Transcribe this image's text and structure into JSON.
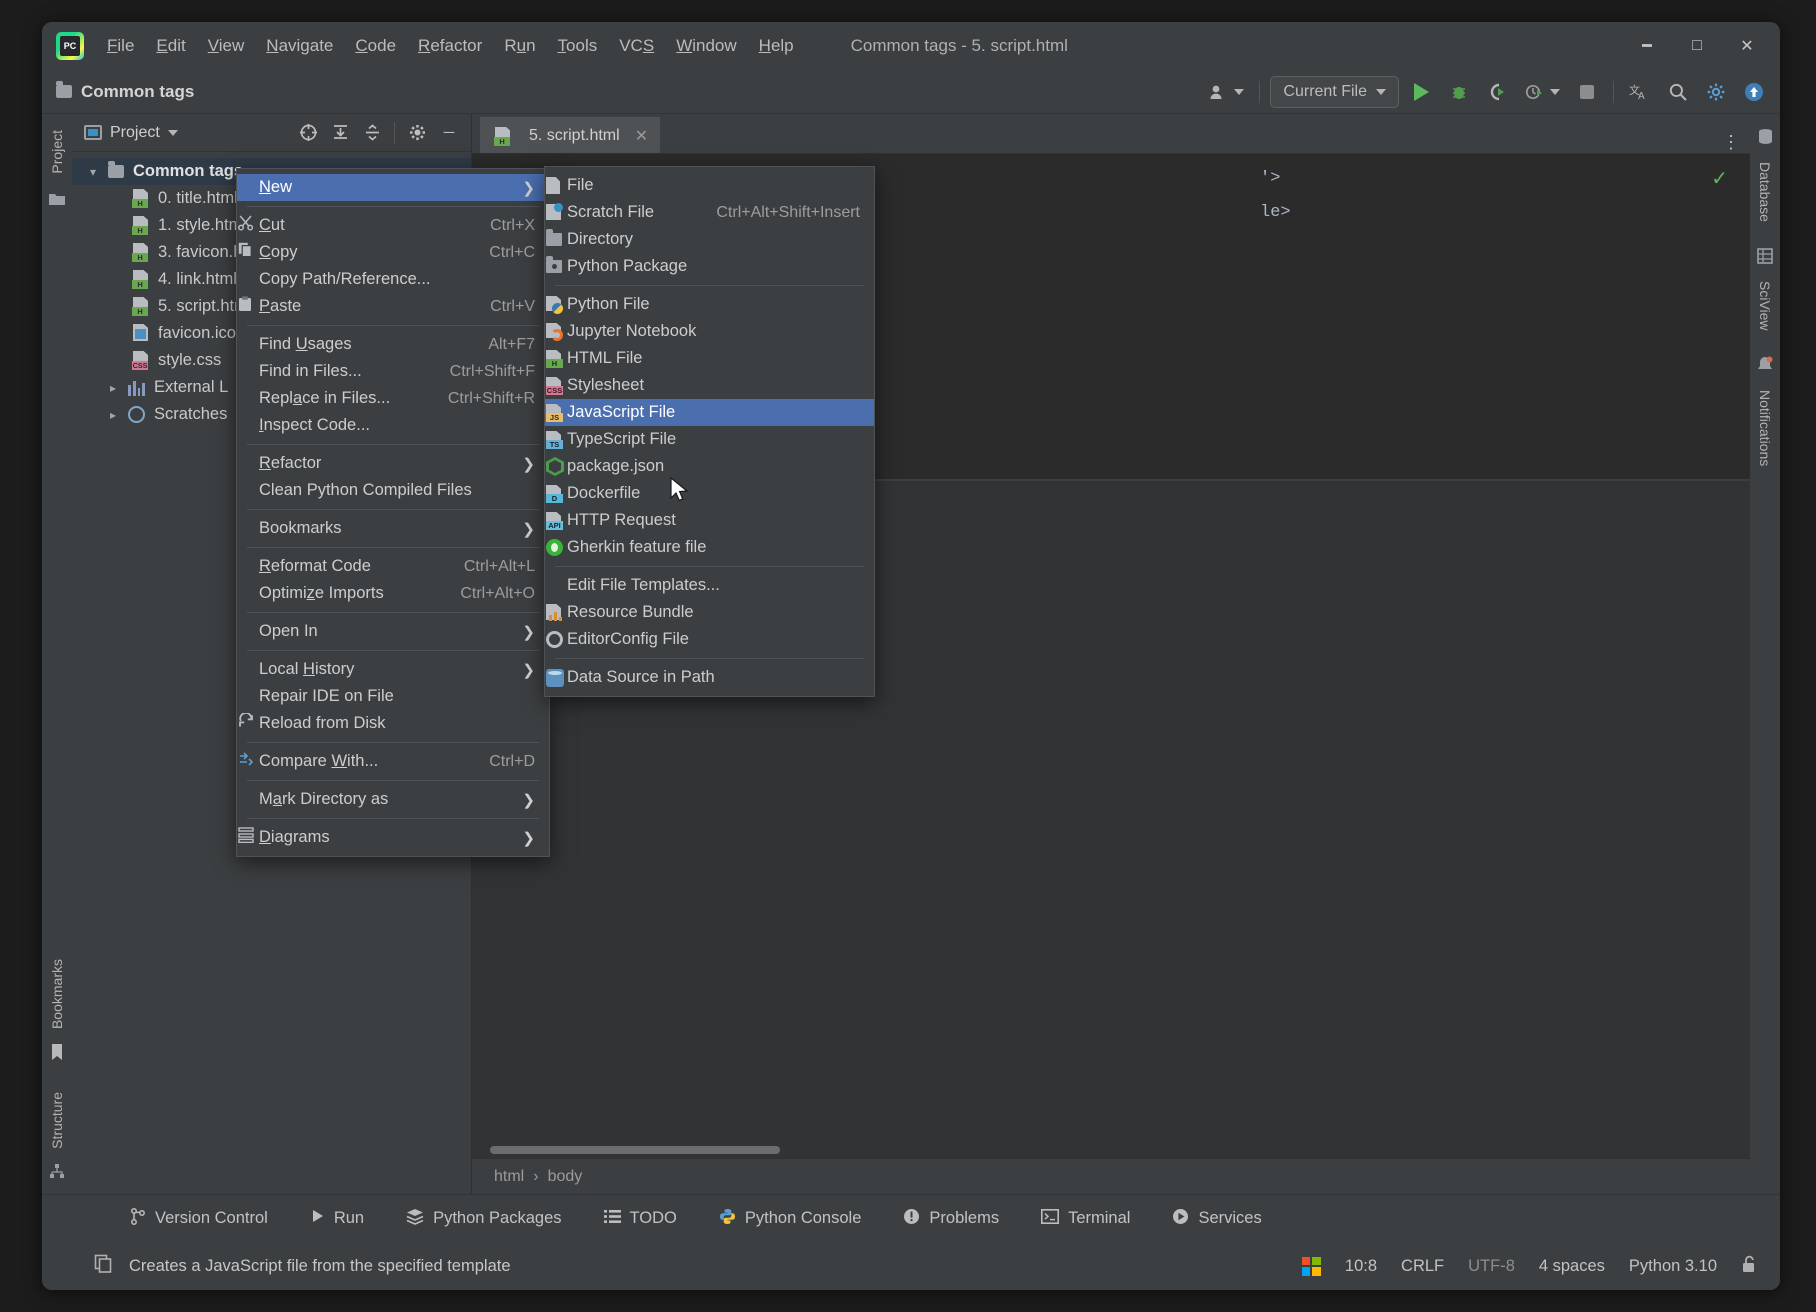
{
  "window": {
    "title": "Common tags - 5. script.html",
    "app_icon": "pycharm-logo",
    "minimize": "─",
    "maximize": "☐",
    "close": "✕"
  },
  "menubar": [
    {
      "label": "File",
      "mnemonic": "F"
    },
    {
      "label": "Edit",
      "mnemonic": "E"
    },
    {
      "label": "View",
      "mnemonic": "V"
    },
    {
      "label": "Navigate",
      "mnemonic": "N"
    },
    {
      "label": "Code",
      "mnemonic": "C"
    },
    {
      "label": "Refactor",
      "mnemonic": "R"
    },
    {
      "label": "Run",
      "mnemonic": "u"
    },
    {
      "label": "Tools",
      "mnemonic": "T"
    },
    {
      "label": "VCS",
      "mnemonic": "S"
    },
    {
      "label": "Window",
      "mnemonic": "W"
    },
    {
      "label": "Help",
      "mnemonic": "H"
    }
  ],
  "projectbar": {
    "title": "Common tags",
    "run_config": "Current File"
  },
  "project_panel": {
    "title": "Project",
    "root": "Common tags",
    "items": [
      {
        "label": "0. title.html",
        "short": "0. title",
        "icon": "html-file-icon",
        "badge": "H"
      },
      {
        "label": "1. style.html",
        "short": "1. styl",
        "icon": "html-file-icon",
        "badge": "H"
      },
      {
        "label": "3. favicon.html",
        "short": "3. favi",
        "icon": "html-file-icon",
        "badge": "H"
      },
      {
        "label": "4. link.html",
        "short": "4. link",
        "icon": "html-file-icon",
        "badge": "H"
      },
      {
        "label": "5. script.html",
        "short": "5. scri",
        "icon": "html-file-icon",
        "badge": "H"
      },
      {
        "label": "favicon.ico",
        "short": "favico",
        "icon": "image-file-icon",
        "badge": ""
      },
      {
        "label": "style.css",
        "short": "style.c",
        "icon": "css-file-icon",
        "badge": "CSS"
      }
    ],
    "external_libraries": "External L",
    "scratches": "Scratches"
  },
  "editor": {
    "tab": "5. script.html",
    "tab_close": "✕",
    "code_lines": [
      "'>",
      "le>"
    ],
    "breadcrumbs": [
      "html",
      "body"
    ],
    "inspection_ok": "✓"
  },
  "rails": {
    "left_top": "Project",
    "left_bottom": [
      "Bookmarks",
      "Structure"
    ],
    "right": [
      "Database",
      "SciView",
      "Notifications"
    ]
  },
  "context_menu": {
    "items": [
      {
        "label": "New",
        "mnemonic": "N",
        "accel": "",
        "submenu": true,
        "highlighted": true,
        "icon": ""
      },
      {
        "separator": true
      },
      {
        "label": "Cut",
        "mnemonic": "C",
        "accel": "Ctrl+X",
        "icon": "scissors-icon"
      },
      {
        "label": "Copy",
        "mnemonic": "C",
        "accel": "Ctrl+C",
        "icon": "copy-icon"
      },
      {
        "label": "Copy Path/Reference...",
        "accel": "",
        "icon": ""
      },
      {
        "label": "Paste",
        "mnemonic": "P",
        "accel": "Ctrl+V",
        "icon": "paste-icon"
      },
      {
        "separator": true
      },
      {
        "label": "Find Usages",
        "mnemonic": "U",
        "accel": "Alt+F7",
        "icon": ""
      },
      {
        "label": "Find in Files...",
        "accel": "Ctrl+Shift+F",
        "icon": ""
      },
      {
        "label": "Replace in Files...",
        "mnemonic": "a",
        "accel": "Ctrl+Shift+R",
        "icon": ""
      },
      {
        "label": "Inspect Code...",
        "mnemonic": "I",
        "accel": "",
        "icon": ""
      },
      {
        "separator": true
      },
      {
        "label": "Refactor",
        "mnemonic": "R",
        "accel": "",
        "submenu": true,
        "icon": ""
      },
      {
        "label": "Clean Python Compiled Files",
        "accel": "",
        "icon": ""
      },
      {
        "separator": true
      },
      {
        "label": "Bookmarks",
        "accel": "",
        "submenu": true,
        "icon": ""
      },
      {
        "separator": true
      },
      {
        "label": "Reformat Code",
        "mnemonic": "R",
        "accel": "Ctrl+Alt+L",
        "icon": ""
      },
      {
        "label": "Optimize Imports",
        "mnemonic": "z",
        "accel": "Ctrl+Alt+O",
        "icon": ""
      },
      {
        "separator": true
      },
      {
        "label": "Open In",
        "accel": "",
        "submenu": true,
        "icon": ""
      },
      {
        "separator": true
      },
      {
        "label": "Local History",
        "mnemonic": "H",
        "accel": "",
        "submenu": true,
        "icon": ""
      },
      {
        "label": "Repair IDE on File",
        "accel": "",
        "icon": ""
      },
      {
        "label": "Reload from Disk",
        "accel": "",
        "icon": "reload-icon"
      },
      {
        "separator": true
      },
      {
        "label": "Compare With...",
        "mnemonic": "W",
        "accel": "Ctrl+D",
        "icon": "compare-icon"
      },
      {
        "separator": true
      },
      {
        "label": "Mark Directory as",
        "mnemonic": "a",
        "accel": "",
        "submenu": true,
        "icon": ""
      },
      {
        "separator": true
      },
      {
        "label": "Diagrams",
        "mnemonic": "D",
        "accel": "",
        "submenu": true,
        "icon": "diagram-icon"
      }
    ]
  },
  "new_submenu": {
    "items": [
      {
        "label": "File",
        "accel": "",
        "icon": "file-icon"
      },
      {
        "label": "Scratch File",
        "accel": "Ctrl+Alt+Shift+Insert",
        "icon": "scratch-file-icon"
      },
      {
        "label": "Directory",
        "accel": "",
        "icon": "directory-icon"
      },
      {
        "label": "Python Package",
        "accel": "",
        "icon": "python-package-icon"
      },
      {
        "separator": true
      },
      {
        "label": "Python File",
        "accel": "",
        "icon": "python-file-icon"
      },
      {
        "label": "Jupyter Notebook",
        "accel": "",
        "icon": "jupyter-notebook-icon"
      },
      {
        "label": "HTML File",
        "accel": "",
        "icon": "html-file-icon",
        "badge": "H"
      },
      {
        "label": "Stylesheet",
        "accel": "",
        "icon": "css-file-icon",
        "badge": "CSS"
      },
      {
        "label": "JavaScript File",
        "accel": "",
        "icon": "javascript-file-icon",
        "badge": "JS",
        "highlighted": true
      },
      {
        "label": "TypeScript File",
        "accel": "",
        "icon": "typescript-file-icon",
        "badge": "TS"
      },
      {
        "label": "package.json",
        "accel": "",
        "icon": "nodejs-icon"
      },
      {
        "label": "Dockerfile",
        "accel": "",
        "icon": "dockerfile-icon",
        "badge": "D"
      },
      {
        "label": "HTTP Request",
        "accel": "",
        "icon": "http-request-icon",
        "badge": "API"
      },
      {
        "label": "Gherkin feature file",
        "accel": "",
        "icon": "cucumber-icon"
      },
      {
        "separator": true
      },
      {
        "label": "Edit File Templates...",
        "accel": "",
        "icon": ""
      },
      {
        "label": "Resource Bundle",
        "accel": "",
        "icon": "resource-bundle-icon"
      },
      {
        "label": "EditorConfig File",
        "accel": "",
        "icon": "editorconfig-icon"
      },
      {
        "separator": true
      },
      {
        "label": "Data Source in Path",
        "accel": "",
        "icon": "database-icon"
      }
    ]
  },
  "tool_windows": [
    {
      "label": "Version Control",
      "icon": "branch-icon"
    },
    {
      "label": "Run",
      "icon": "play-icon"
    },
    {
      "label": "Python Packages",
      "icon": "packages-icon"
    },
    {
      "label": "TODO",
      "icon": "list-icon"
    },
    {
      "label": "Python Console",
      "icon": "python-icon"
    },
    {
      "label": "Problems",
      "icon": "warning-icon"
    },
    {
      "label": "Terminal",
      "icon": "terminal-icon"
    },
    {
      "label": "Services",
      "icon": "services-icon"
    }
  ],
  "statusbar": {
    "message": "Creates a JavaScript file from the specified template",
    "message_icon": "copy-icon",
    "os_icon": "windows-logo",
    "caret": "10:8",
    "line_separator": "CRLF",
    "encoding": "UTF-8",
    "indent": "4 spaces",
    "interpreter": "Python 3.10",
    "lock_icon": "unlocked-icon"
  },
  "colors": {
    "accent": "#4b6eaf",
    "panel": "#3c3f41",
    "editor": "#2b2b2b",
    "text": "#cdcdcd",
    "green": "#5db85d"
  }
}
